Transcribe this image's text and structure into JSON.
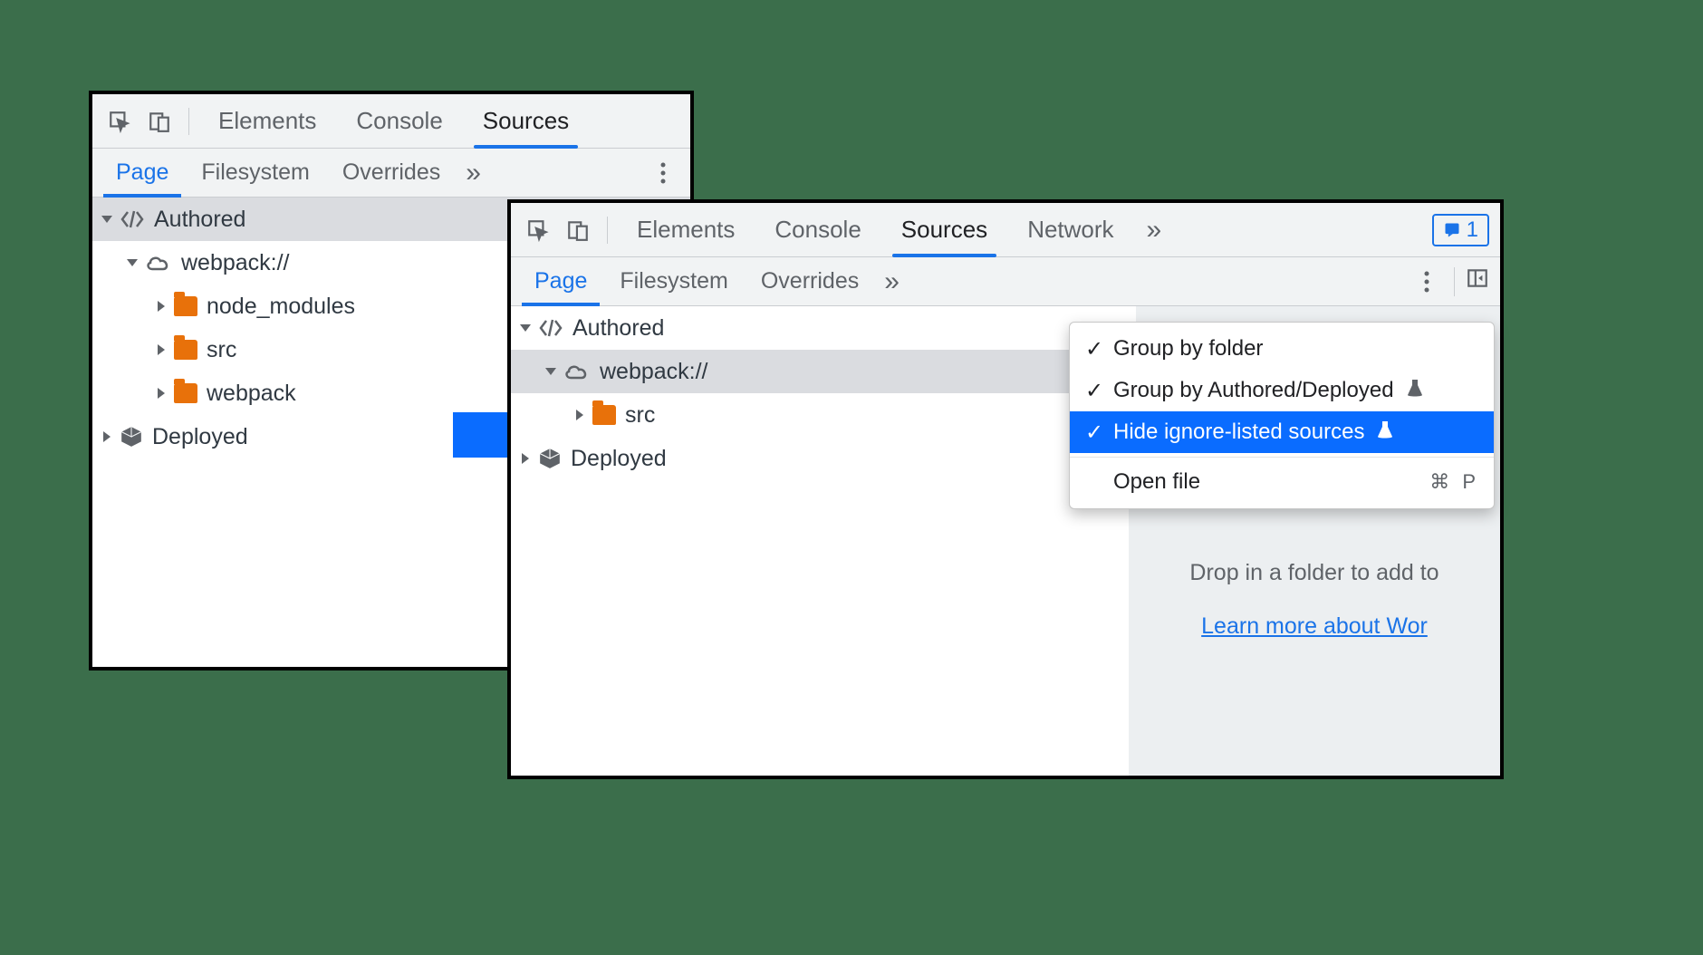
{
  "tabs": {
    "elements": "Elements",
    "console": "Console",
    "sources": "Sources",
    "network": "Network"
  },
  "subtabs": {
    "page": "Page",
    "filesystem": "Filesystem",
    "overrides": "Overrides"
  },
  "issues_badge": "1",
  "tree_left": {
    "authored": "Authored",
    "webpack": "webpack://",
    "node_modules": "node_modules",
    "src": "src",
    "webpack_folder": "webpack",
    "deployed": "Deployed"
  },
  "tree_right": {
    "authored": "Authored",
    "webpack": "webpack://",
    "src": "src",
    "deployed": "Deployed"
  },
  "context_menu": {
    "group_by_folder": "Group by folder",
    "group_by_authored": "Group by Authored/Deployed",
    "hide_ignore": "Hide ignore-listed sources",
    "open_file": "Open file",
    "open_file_shortcut": "⌘ P"
  },
  "drop_hint": {
    "line": "Drop in a folder to add to",
    "link": "Learn more about Wor"
  }
}
